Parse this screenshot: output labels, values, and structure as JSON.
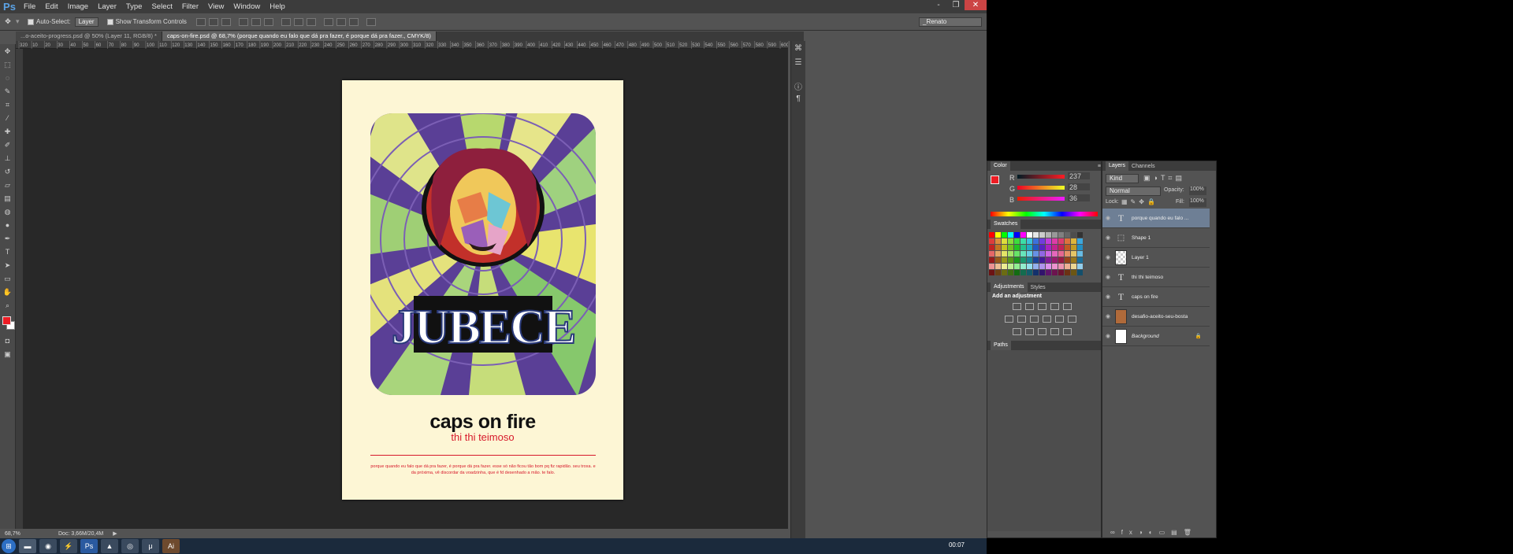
{
  "app": {
    "logo": "Ps"
  },
  "menu": [
    "File",
    "Edit",
    "Image",
    "Layer",
    "Type",
    "Select",
    "Filter",
    "View",
    "Window",
    "Help"
  ],
  "window_controls": {
    "minimize": "-",
    "restore": "❐",
    "close": "✕"
  },
  "options": {
    "auto_select_label": "Auto-Select:",
    "auto_select_value": "Layer",
    "transform_label": "Show Transform Controls",
    "workspace": "_Renato"
  },
  "tabs": [
    {
      "label": "...o-aceito-progress.psd @ 50% (Layer 11, RGB/8) *",
      "active": false
    },
    {
      "label": "caps-on-fire.psd @ 68,7% (porque quando eu falo que dá pra fazer, é porque dá pra fazer., CMYK/8)",
      "active": true
    }
  ],
  "ruler_ticks": [
    "320",
    "10",
    "20",
    "30",
    "40",
    "50",
    "60",
    "70",
    "80",
    "90",
    "100",
    "110",
    "120",
    "130",
    "140",
    "150",
    "160",
    "170",
    "180",
    "190",
    "200",
    "210",
    "220",
    "230",
    "240",
    "250",
    "260",
    "270",
    "280",
    "290",
    "300",
    "310",
    "320",
    "330",
    "340",
    "350",
    "360",
    "370",
    "380",
    "390",
    "400",
    "410",
    "420",
    "430",
    "440",
    "450",
    "460",
    "470",
    "480",
    "490",
    "500",
    "510",
    "520",
    "530",
    "540",
    "550",
    "560",
    "570",
    "580",
    "590",
    "600"
  ],
  "poster": {
    "title": "caps on fire",
    "subtitle": "thi thi teimoso",
    "body": "porque quando eu falo que dá pra fazer, é porque dá pra fazer. esse só não ficou tão bom pq fiz rapidão. seu troxa. e da próxima, vê discordar da voadzinha, que é fd desenhado a mão. te falo."
  },
  "status": {
    "zoom": "68,7%",
    "doc": "Doc: 3,66M/20,4M"
  },
  "color_panel": {
    "title": "Color",
    "r_label": "R",
    "r": "237",
    "g_label": "G",
    "g": "28",
    "b_label": "B",
    "b": "36",
    "fg": "#ed1c24"
  },
  "swatches_title": "Swatches",
  "adjustments": {
    "title": "Adjustments",
    "styles": "Styles",
    "add_label": "Add an adjustment"
  },
  "paths_title": "Paths",
  "layers_panel": {
    "tab_layers": "Layers",
    "tab_channels": "Channels",
    "kind": "Kind",
    "blend": "Normal",
    "opacity_label": "Opacity:",
    "opacity": "100%",
    "lock_label": "Lock:",
    "fill_label": "Fill:",
    "fill": "100%",
    "layers": [
      {
        "name": "porque quando eu falo ...",
        "type": "text",
        "selected": true
      },
      {
        "name": "Shape 1",
        "type": "shape",
        "selected": false
      },
      {
        "name": "Layer 1",
        "type": "pixel",
        "selected": false
      },
      {
        "name": "thi thi teimoso",
        "type": "text",
        "selected": false
      },
      {
        "name": "caps on fire",
        "type": "text",
        "selected": false
      },
      {
        "name": "desafio-aceito-seu-bosta",
        "type": "image",
        "selected": false
      },
      {
        "name": "Background",
        "type": "background",
        "selected": false
      }
    ]
  },
  "taskbar": {
    "clock": "00:07"
  }
}
